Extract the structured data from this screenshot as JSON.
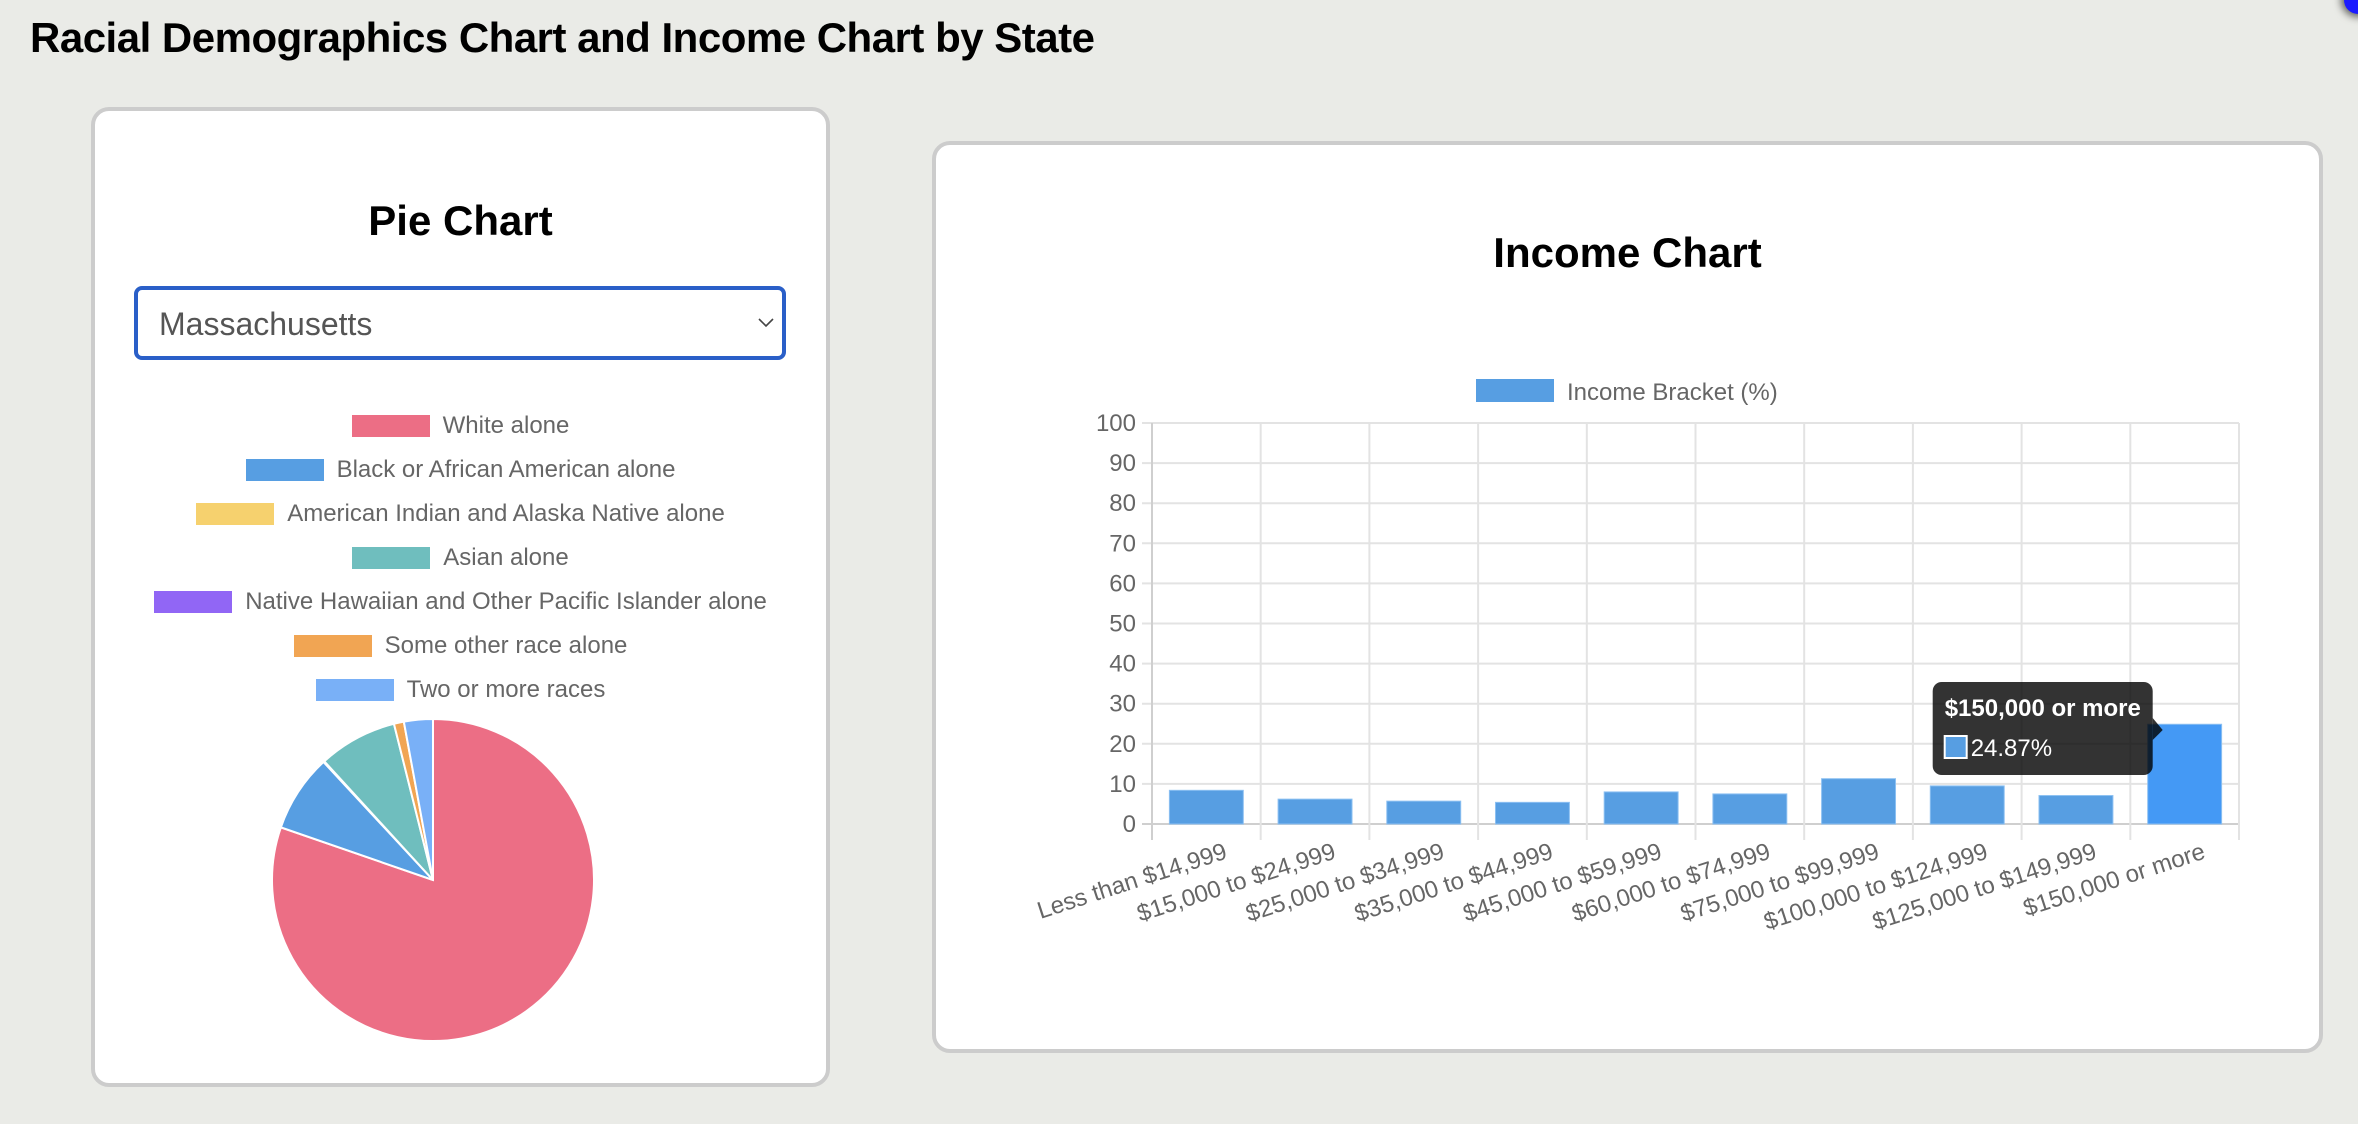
{
  "page": {
    "title": "Racial Demographics Chart and Income Chart by State"
  },
  "pie_panel": {
    "title": "Pie Chart",
    "state_select": {
      "selected": "Massachusetts",
      "chevron_icon": "chevron-down-icon"
    }
  },
  "income_panel": {
    "title": "Income Chart"
  },
  "chart_data": [
    {
      "type": "pie",
      "title": "Pie Chart",
      "state": "Massachusetts",
      "legend_position": "top",
      "categories": [
        "White alone",
        "Black or African American alone",
        "American Indian and Alaska Native alone",
        "Asian alone",
        "Native Hawaiian and Other Pacific Islander alone",
        "Some other race alone",
        "Two or more races"
      ],
      "values": [
        80.3,
        7.8,
        0.1,
        7.9,
        0.0,
        1.0,
        2.9
      ],
      "colors": [
        "#ec6e85",
        "#579ee2",
        "#f6d16e",
        "#6fbebe",
        "#9166f5",
        "#f1a553",
        "#79b0f7"
      ]
    },
    {
      "type": "bar",
      "title": "Income Chart",
      "legend_position": "top",
      "series": [
        {
          "name": "Income Bracket (%)",
          "color": "#579ee2",
          "hover_color": "#4499f5",
          "values": [
            8.4,
            6.2,
            5.7,
            5.4,
            8.0,
            7.5,
            11.3,
            9.5,
            7.1,
            24.87
          ]
        }
      ],
      "categories": [
        "Less than $14,999",
        "$15,000 to $24,999",
        "$25,000 to $34,999",
        "$35,000 to $44,999",
        "$45,000 to $59,999",
        "$60,000 to $74,999",
        "$75,000 to $99,999",
        "$100,000 to $124,999",
        "$125,000 to $149,999",
        "$150,000 or more"
      ],
      "xlabel": "",
      "ylabel": "",
      "ylim": [
        0,
        100
      ],
      "yticks": [
        0,
        10,
        20,
        30,
        40,
        50,
        60,
        70,
        80,
        90,
        100
      ],
      "grid": true,
      "tooltip": {
        "visible": true,
        "category_index": 9,
        "title": "$150,000 or more",
        "value_text": "24.87%"
      }
    }
  ]
}
